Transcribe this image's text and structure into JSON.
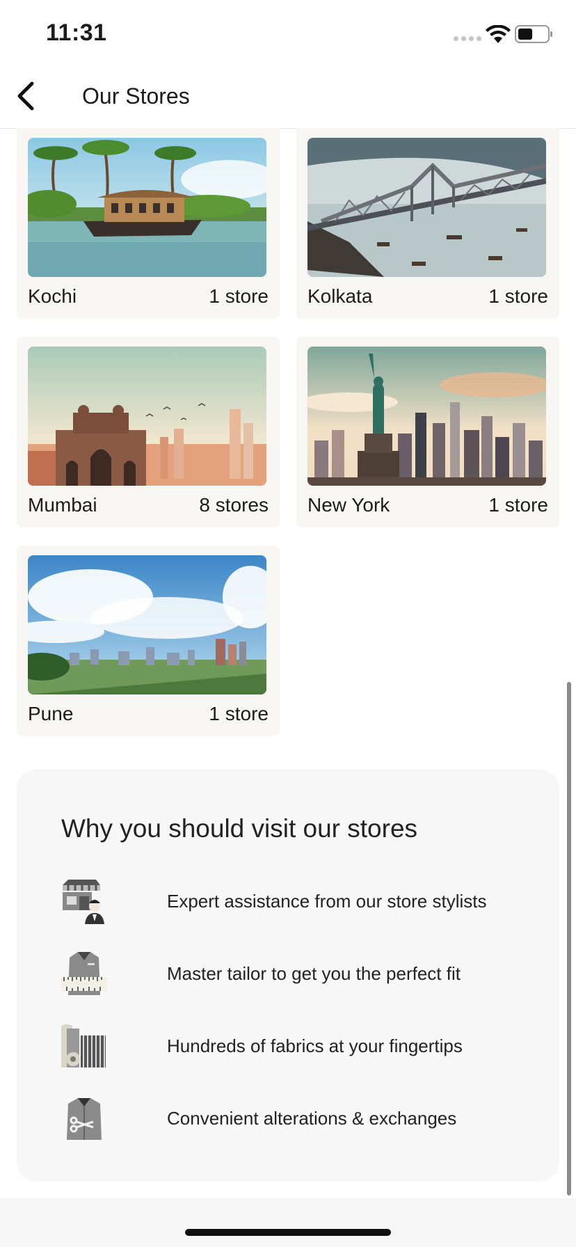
{
  "status_bar": {
    "time": "11:31"
  },
  "header": {
    "title": "Our Stores",
    "back_icon": "chevron-left-icon"
  },
  "cities": [
    {
      "name": "Kochi",
      "count": "1 store",
      "image": "houseboat-backwaters-illustration"
    },
    {
      "name": "Kolkata",
      "count": "1 store",
      "image": "howrah-bridge-illustration"
    },
    {
      "name": "Mumbai",
      "count": "8 stores",
      "image": "gateway-of-india-illustration"
    },
    {
      "name": "New York",
      "count": "1 store",
      "image": "statue-of-liberty-skyline-illustration"
    },
    {
      "name": "Pune",
      "count": "1 store",
      "image": "city-skyline-clouds-illustration"
    }
  ],
  "benefits": {
    "title": "Why you should visit our stores",
    "items": [
      {
        "icon": "store-stylist-icon",
        "text": "Expert assistance from our store stylists"
      },
      {
        "icon": "tailor-measure-icon",
        "text": "Master tailor to get you the perfect fit"
      },
      {
        "icon": "fabric-rolls-icon",
        "text": "Hundreds of fabrics at your fingertips"
      },
      {
        "icon": "shirt-scissors-icon",
        "text": "Convenient alterations & exchanges"
      }
    ]
  }
}
